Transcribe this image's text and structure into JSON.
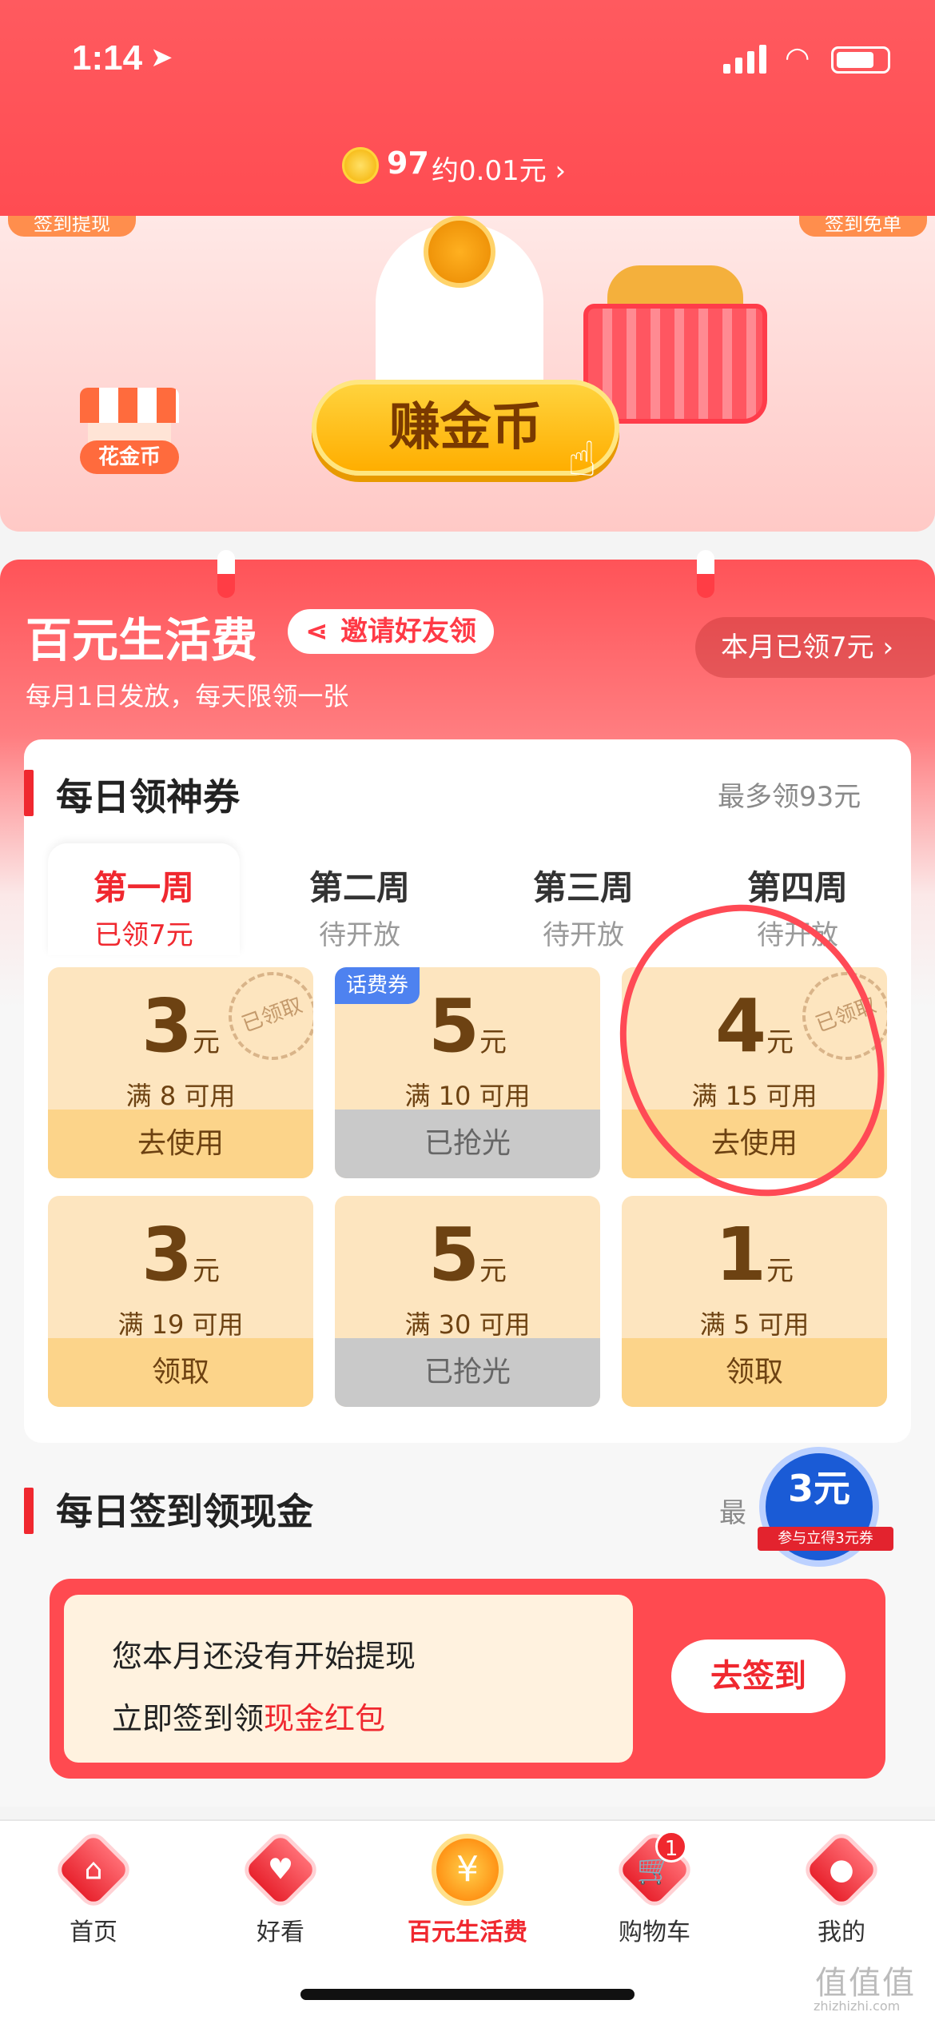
{
  "status_bar": {
    "time": "1:14"
  },
  "header": {
    "coin_count": "97",
    "coin_value": "约0.01元 ›"
  },
  "banner": {
    "tag_left": "签到提现",
    "tag_right": "签到免单",
    "spend_label": "花金币",
    "earn_label": "赚金币"
  },
  "section": {
    "title": "百元生活费",
    "invite_label": "邀请好友领",
    "monthly_label": "本月已领7元 ›",
    "subtitle": "每月1日发放，每天限领一张"
  },
  "coupon_card": {
    "title": "每日领神券",
    "right_label": "最多领93元",
    "weeks": [
      {
        "title": "第一周",
        "status": "已领7元"
      },
      {
        "title": "第二周",
        "status": "待开放"
      },
      {
        "title": "第三周",
        "status": "待开放"
      },
      {
        "title": "第四周",
        "status": "待开放"
      }
    ],
    "coupons": [
      {
        "amount": "3",
        "unit": "元",
        "condition": "满 8 可用",
        "button": "去使用",
        "stamp": "已领取",
        "tag": "",
        "state": "claimed"
      },
      {
        "amount": "5",
        "unit": "元",
        "condition": "满 10 可用",
        "button": "已抢光",
        "stamp": "",
        "tag": "话费券",
        "state": "soldout"
      },
      {
        "amount": "4",
        "unit": "元",
        "condition": "满 15 可用",
        "button": "去使用",
        "stamp": "已领取",
        "tag": "",
        "state": "claimed"
      },
      {
        "amount": "3",
        "unit": "元",
        "condition": "满 19 可用",
        "button": "领取",
        "stamp": "",
        "tag": "",
        "state": "available"
      },
      {
        "amount": "5",
        "unit": "元",
        "condition": "满 30 可用",
        "button": "已抢光",
        "stamp": "",
        "tag": "",
        "state": "soldout"
      },
      {
        "amount": "1",
        "unit": "元",
        "condition": "满 5 可用",
        "button": "领取",
        "stamp": "",
        "tag": "",
        "state": "available"
      }
    ]
  },
  "sign_card": {
    "title": "每日签到领现金",
    "right_label": "最",
    "line1": "您本月还没有开始提现",
    "line2_prefix": "立即签到领",
    "line2_highlight": "现金红包",
    "button": "去签到",
    "badge_amount": "3元",
    "badge_text": "参与立得3元券"
  },
  "tab_bar": {
    "items": [
      {
        "label": "首页",
        "icon": "home-icon"
      },
      {
        "label": "好看",
        "icon": "heart-icon"
      },
      {
        "label": "百元生活费",
        "icon": "money-bag-icon"
      },
      {
        "label": "购物车",
        "icon": "cart-icon"
      },
      {
        "label": "我的",
        "icon": "person-icon"
      }
    ],
    "cart_badge": "1"
  },
  "watermark": {
    "text": "值值值",
    "sub": "zhizhizhi.com"
  },
  "colors": {
    "accent": "#f0282f",
    "header": "#ff5a5f",
    "coupon": "#fde5bf",
    "coupon_button": "#fcd48a",
    "tag_blue": "#4e82f0"
  }
}
